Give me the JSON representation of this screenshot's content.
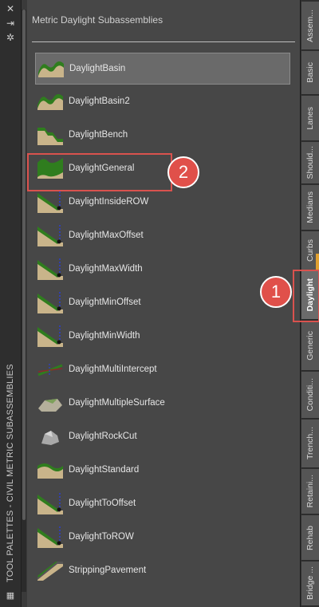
{
  "window": {
    "palette_title": "TOOL PALETTES - CIVIL METRIC SUBASSEMBLIES",
    "close_glyph": "✕",
    "autohide_glyph": "⇥",
    "properties_glyph": "✲"
  },
  "panel": {
    "title": "Metric Daylight Subassemblies",
    "items": [
      {
        "label": "DaylightBasin",
        "icon": "basin-icon"
      },
      {
        "label": "DaylightBasin2",
        "icon": "basin-icon"
      },
      {
        "label": "DaylightBench",
        "icon": "bench-icon"
      },
      {
        "label": "DaylightGeneral",
        "icon": "general-icon"
      },
      {
        "label": "DaylightInsideROW",
        "icon": "slope-icon"
      },
      {
        "label": "DaylightMaxOffset",
        "icon": "slope-icon"
      },
      {
        "label": "DaylightMaxWidth",
        "icon": "slope-icon"
      },
      {
        "label": "DaylightMinOffset",
        "icon": "slope-icon"
      },
      {
        "label": "DaylightMinWidth",
        "icon": "slope-icon"
      },
      {
        "label": "DaylightMultiIntercept",
        "icon": "intercept-icon"
      },
      {
        "label": "DaylightMultipleSurface",
        "icon": "surface-icon"
      },
      {
        "label": "DaylightRockCut",
        "icon": "rock-icon"
      },
      {
        "label": "DaylightStandard",
        "icon": "standard-icon"
      },
      {
        "label": "DaylightToOffset",
        "icon": "slope-icon"
      },
      {
        "label": "DaylightToROW",
        "icon": "slope-icon"
      },
      {
        "label": "StrippingPavement",
        "icon": "pavement-icon"
      }
    ]
  },
  "tabs": [
    "Assem...",
    "Basic",
    "Lanes",
    "Should...",
    "Medians",
    "Curbs",
    "Daylight",
    "Generic",
    "Conditi...",
    "Trench...",
    "Retaini...",
    "Rehab",
    "Bridge ..."
  ],
  "active_tab": "Daylight",
  "callouts": [
    "1",
    "2"
  ],
  "colors": {
    "callout": "#e0504a",
    "grass": "#2f7d1e",
    "soil": "#c9b48a",
    "line": "#2b3fd1"
  }
}
